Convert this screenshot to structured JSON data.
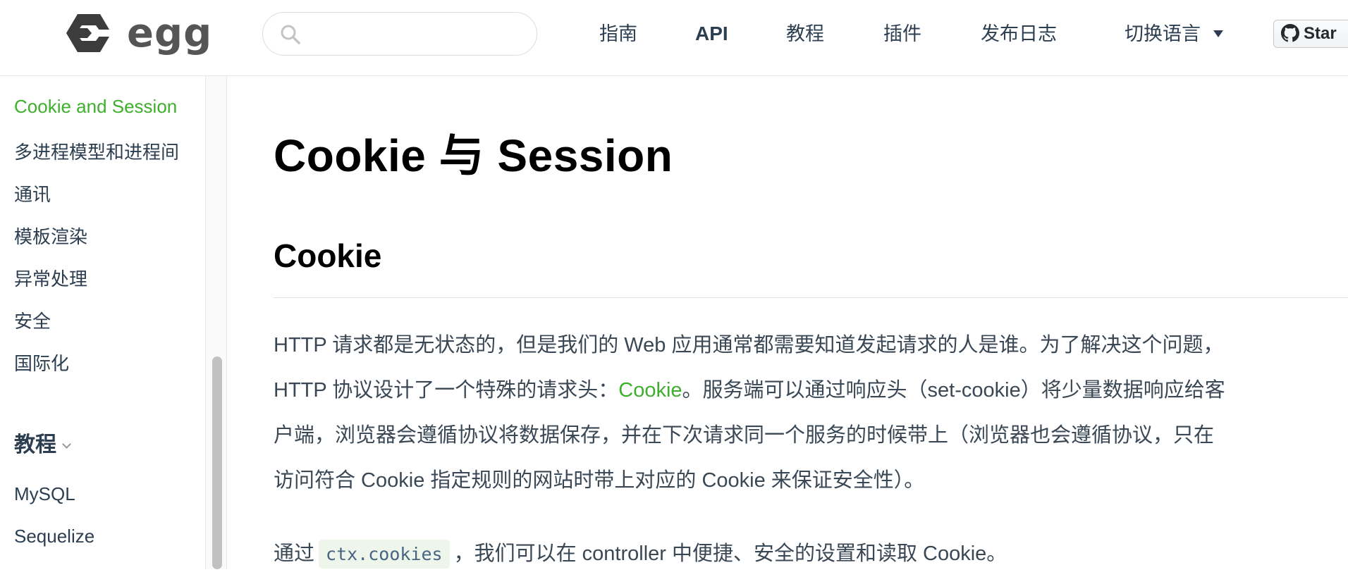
{
  "header": {
    "brand": "egg",
    "search": {
      "placeholder": ""
    },
    "nav": {
      "guide": "指南",
      "api": "API",
      "tutorial": "教程",
      "plugins": "插件",
      "release": "发布日志",
      "language": "切换语言"
    },
    "star": "Star"
  },
  "sidebar": {
    "items": [
      {
        "label": "Cookie and Session",
        "active": true
      },
      {
        "label": "多进程模型和进程间"
      },
      {
        "label": "通讯"
      },
      {
        "label": "模板渲染"
      },
      {
        "label": "异常处理"
      },
      {
        "label": "安全"
      },
      {
        "label": "国际化"
      }
    ],
    "group": "教程",
    "group_items": [
      {
        "label": "MySQL"
      },
      {
        "label": "Sequelize"
      }
    ]
  },
  "content": {
    "title": "Cookie 与 Session",
    "section": "Cookie",
    "para1": {
      "line1": "HTTP 请求都是无状态的，但是我们的 Web 应用通常都需要知道发起请求的人是谁。为了解决这个问题，",
      "line2_pre": "HTTP 协议设计了一个特殊的请求头：",
      "line2_link": "Cookie",
      "line2_post": "。服务端可以通过响应头（set-cookie）将少量数据响应给客",
      "line3": "户端，浏览器会遵循协议将数据保存，并在下次请求同一个服务的时候带上（浏览器也会遵循协议，只在",
      "line4": "访问符合 Cookie 指定规则的网站时带上对应的 Cookie 来保证安全性）。"
    },
    "para2": {
      "pre": "通过",
      "code": "ctx.cookies",
      "post": "，我们可以在 controller 中便捷、安全的设置和读取 Cookie。"
    }
  },
  "colors": {
    "accent": "#3eaf2c",
    "text": "#2c3e50"
  }
}
